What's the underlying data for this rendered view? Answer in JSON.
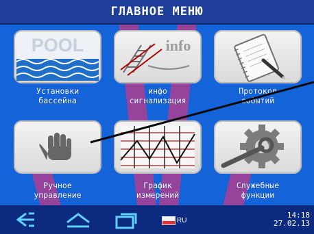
{
  "header": {
    "title": "ГЛАВНОЕ МЕНЮ"
  },
  "tiles": [
    {
      "line1": "Установки",
      "line2": "бассейна",
      "icon": "pool-icon",
      "icon_text": "POOL"
    },
    {
      "line1": "инфо",
      "line2": "сигнализация",
      "icon": "info-ladder-icon",
      "icon_text": "info"
    },
    {
      "line1": "Протокол",
      "line2": "событий",
      "icon": "notebook-pen-icon"
    },
    {
      "line1": "Ручное",
      "line2": "управление",
      "icon": "hand-icon"
    },
    {
      "line1": "График",
      "line2": "измерений",
      "icon": "graph-icon"
    },
    {
      "line1": "Служебные",
      "line2": "функции",
      "icon": "gear-wrench-icon"
    }
  ],
  "footer": {
    "buttons": [
      "back-icon",
      "home-icon",
      "windows-icon"
    ],
    "language": "RU",
    "time": "14:18",
    "date": "27.02.13"
  },
  "colors": {
    "background": "#1563d8",
    "header": "#1f3f9a",
    "footer": "#0c2a80",
    "watermark": "#ff2a5a"
  }
}
